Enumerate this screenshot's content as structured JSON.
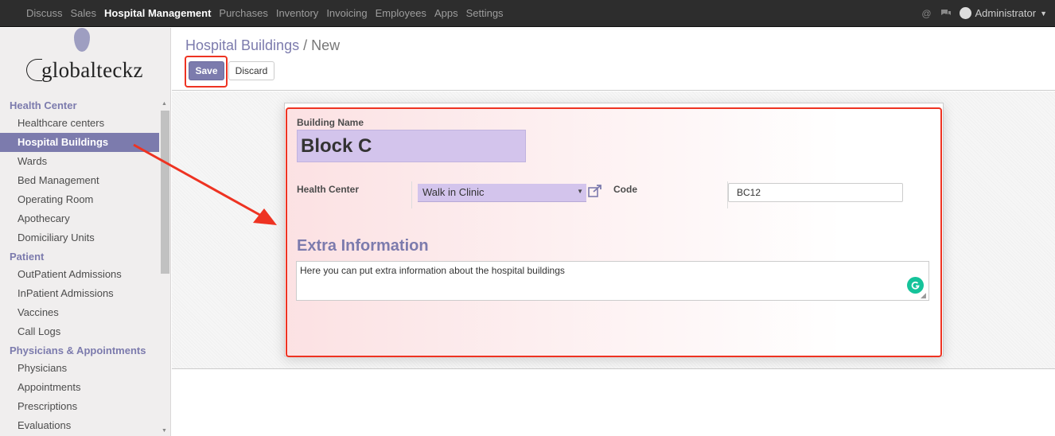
{
  "topbar": {
    "menu": [
      "Discuss",
      "Sales",
      "Hospital Management",
      "Purchases",
      "Inventory",
      "Invoicing",
      "Employees",
      "Apps",
      "Settings"
    ],
    "active_menu": "Hospital Management",
    "user_name": "Administrator",
    "icons": [
      "at-icon",
      "chat-icon"
    ]
  },
  "sidebar": {
    "logo_text": "globalteckz",
    "sections": [
      {
        "title": "Health Center",
        "items": [
          "Healthcare centers",
          "Hospital Buildings",
          "Wards",
          "Bed Management",
          "Operating Room",
          "Apothecary",
          "Domiciliary Units"
        ]
      },
      {
        "title": "Patient",
        "items": [
          "OutPatient Admissions",
          "InPatient Admissions",
          "Vaccines",
          "Call Logs"
        ]
      },
      {
        "title": "Physicians & Appointments",
        "items": [
          "Physicians",
          "Appointments",
          "Prescriptions",
          "Evaluations"
        ]
      }
    ],
    "active_item": "Hospital Buildings"
  },
  "control": {
    "breadcrumb_parent": "Hospital Buildings",
    "breadcrumb_separator": "/",
    "breadcrumb_current": "New",
    "save_label": "Save",
    "discard_label": "Discard"
  },
  "form": {
    "building_name_label": "Building Name",
    "building_name_value": "Block C",
    "health_center_label": "Health Center",
    "health_center_value": "Walk in Clinic",
    "code_label": "Code",
    "code_value": "BC12",
    "extra_title": "Extra Information",
    "extra_value": "Here you can put extra information about the hospital buildings"
  },
  "colors": {
    "accent": "#7c7bad",
    "highlight": "#ee2222",
    "topbar": "#2d2d2d"
  }
}
